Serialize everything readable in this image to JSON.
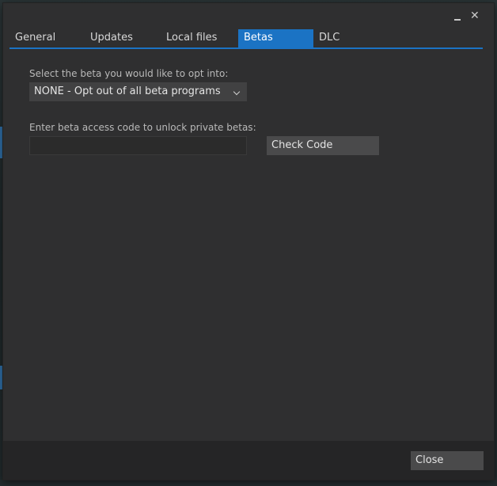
{
  "window": {
    "minimize_glyph": "",
    "close_glyph": "✕"
  },
  "tabs": [
    {
      "label": "General"
    },
    {
      "label": "Updates"
    },
    {
      "label": "Local files"
    },
    {
      "label": "Betas",
      "active": true
    },
    {
      "label": "DLC"
    }
  ],
  "betas": {
    "select_label": "Select the beta you would like to opt into:",
    "selected_value": "NONE - Opt out of all beta programs",
    "code_label": "Enter beta access code to unlock private betas:",
    "code_value": "",
    "check_button_label": "Check Code"
  },
  "footer": {
    "close_button_label": "Close"
  },
  "icons": {
    "minimize": "minimize-icon",
    "close": "close-icon",
    "dropdown": "chevron-down-icon"
  },
  "colors": {
    "accent": "#1b73c4",
    "window_bg": "#2f2f30",
    "footer_bg": "#252526"
  }
}
